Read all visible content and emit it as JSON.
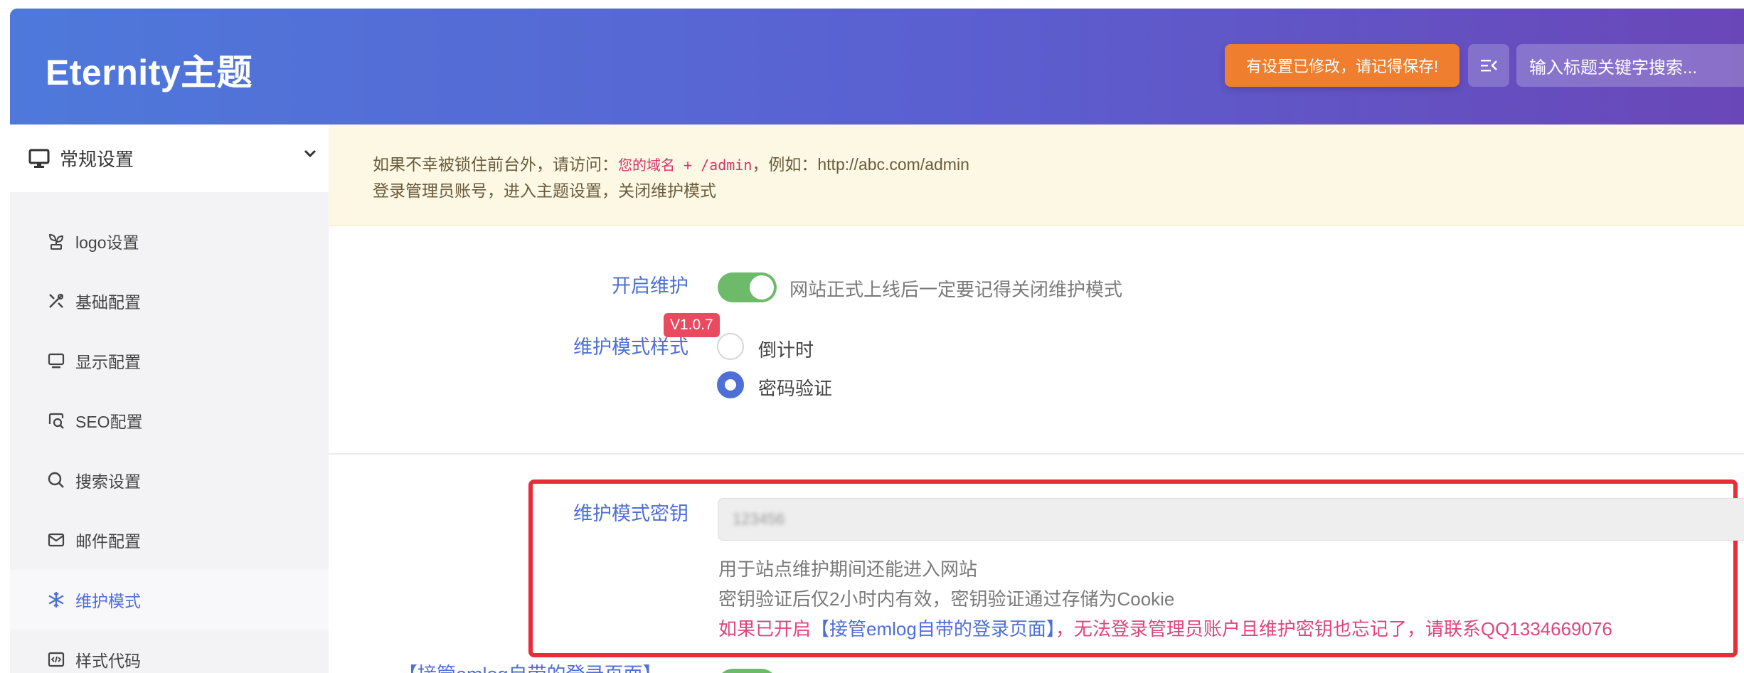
{
  "header": {
    "brand": "Eternity主题",
    "save_notice": "有设置已修改，请记得保存!",
    "search_placeholder": "输入标题关键字搜索..."
  },
  "sidebar": {
    "group_label": "常规设置",
    "items": [
      {
        "label": "logo设置",
        "icon": "sprout-icon"
      },
      {
        "label": "基础配置",
        "icon": "tools-icon"
      },
      {
        "label": "显示配置",
        "icon": "monitor-icon"
      },
      {
        "label": "SEO配置",
        "icon": "seo-icon"
      },
      {
        "label": "搜索设置",
        "icon": "search-icon"
      },
      {
        "label": "邮件配置",
        "icon": "mail-icon"
      },
      {
        "label": "维护模式",
        "icon": "snowflake-icon",
        "active": true
      },
      {
        "label": "样式代码",
        "icon": "code-icon"
      }
    ]
  },
  "notice": {
    "line1_prefix": "如果不幸被锁住前台外，请访问：",
    "line1_code": "您的域名 + /admin",
    "line1_suffix": "，例如：http://abc.com/admin",
    "line2": "登录管理员账号，进入主题设置，关闭维护模式"
  },
  "maintenance": {
    "enable_label": "开启维护",
    "enable_on": true,
    "enable_desc": "网站正式上线后一定要记得关闭维护模式",
    "mode_label": "维护模式样式",
    "version_badge": "V1.0.7",
    "options": [
      {
        "label": "倒计时",
        "checked": false
      },
      {
        "label": "密码验证",
        "checked": true
      }
    ],
    "key_label": "维护模式密钥",
    "key_value": "123456",
    "help1": "用于站点维护期间还能进入网站",
    "help2": "密钥验证后仅2小时内有效，密钥验证通过存储为Cookie",
    "warn_prefix": "如果已开启",
    "warn_link": "【接管emlog自带的登录页面】",
    "warn_suffix": "，无法登录管理员账户且维护密钥也忘记了，请联系QQ1334669076",
    "next_label": "【接管emlog自带的登录页面】"
  },
  "colors": {
    "header_start": "#4e79db",
    "header_end": "#6a47b8",
    "accent": "#4e6fd6",
    "toggle_on": "#6dbb6a",
    "save_notice": "#ef7e2e",
    "highlight": "#ea2b3a",
    "warning_text": "#e0457b"
  }
}
